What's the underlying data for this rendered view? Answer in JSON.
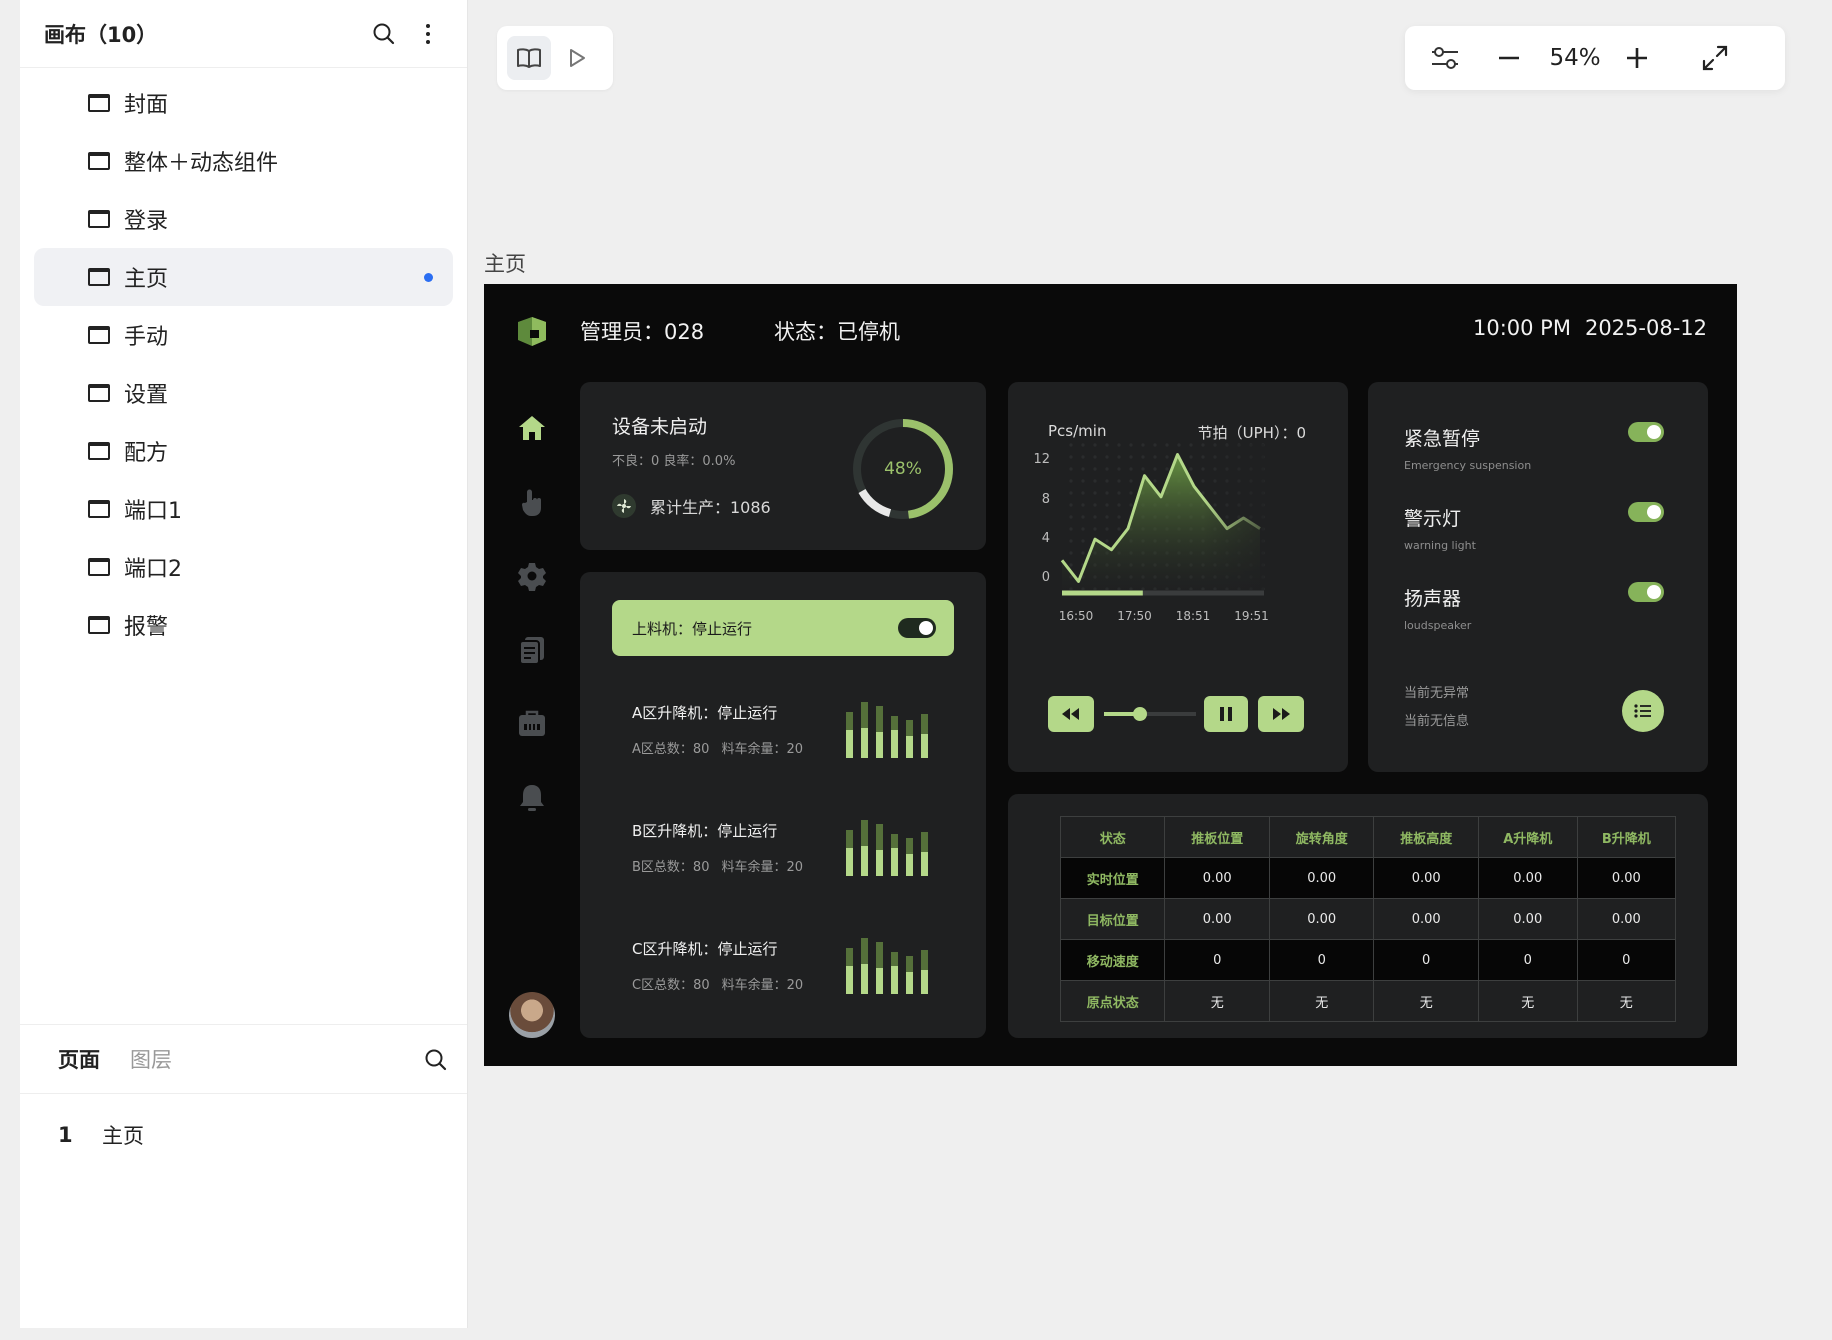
{
  "sidebar": {
    "title": "画布（10）",
    "pages": [
      {
        "label": "封面",
        "active": false
      },
      {
        "label": "整体＋动态组件",
        "active": false
      },
      {
        "label": "登录",
        "active": false
      },
      {
        "label": "主页",
        "active": true
      },
      {
        "label": "手动",
        "active": false
      },
      {
        "label": "设置",
        "active": false
      },
      {
        "label": "配方",
        "active": false
      },
      {
        "label": "端口1",
        "active": false
      },
      {
        "label": "端口2",
        "active": false
      },
      {
        "label": "报警",
        "active": false
      }
    ],
    "tabs": {
      "pages": "页面",
      "layers": "图层"
    },
    "layer": {
      "index": "1",
      "name": "主页"
    }
  },
  "toolbar": {
    "zoom": "54%"
  },
  "frame_label": "主页",
  "dashboard": {
    "admin": "管理员：028",
    "status": "状态：已停机",
    "time": "10:00 PM",
    "date": "2025-08-12",
    "device": {
      "title": "设备未启动",
      "sub": "不良：0  良率：0.0%",
      "accum": "累计生产：1086",
      "progress_percent": 48,
      "progress_label": "48%"
    },
    "feeder": "上料机：停止运行",
    "lifts": [
      {
        "name": "A区升降机：停止运行",
        "total": "A区总数：80",
        "remain": "料车余量：20"
      },
      {
        "name": "B区升降机：停止运行",
        "total": "B区总数：80",
        "remain": "料车余量：20"
      },
      {
        "name": "C区升降机：停止运行",
        "total": "C区总数：80",
        "remain": "料车余量：20"
      }
    ],
    "rate": {
      "unit": "Pcs/min",
      "uph": "节拍（UPH）：0",
      "progress": 0.4
    },
    "alarms": [
      {
        "name": "紧急暂停",
        "sub": "Emergency suspension",
        "on": true
      },
      {
        "name": "警示灯",
        "sub": "warning light",
        "on": true
      },
      {
        "name": "扬声器",
        "sub": "loudspeaker",
        "on": true
      }
    ],
    "messages": [
      "当前无异常",
      "当前无信息"
    ],
    "table": {
      "headers": [
        "状态",
        "推板位置",
        "旋转角度",
        "推板高度",
        "A升降机",
        "B升降机"
      ],
      "rows": [
        [
          "实时位置",
          "0.00",
          "0.00",
          "0.00",
          "0.00",
          "0.00"
        ],
        [
          "目标位置",
          "0.00",
          "0.00",
          "0.00",
          "0.00",
          "0.00"
        ],
        [
          "移动速度",
          "0",
          "0",
          "0",
          "0",
          "0"
        ],
        [
          "原点状态",
          "无",
          "无",
          "无",
          "无",
          "无"
        ]
      ]
    }
  },
  "chart_data": {
    "type": "area",
    "x_ticks": [
      "16:50",
      "17:50",
      "18:51",
      "19:51"
    ],
    "y_ticks": [
      12,
      8,
      4,
      0
    ],
    "ylim": [
      0,
      14
    ],
    "values": [
      3,
      1,
      5,
      4,
      6,
      11,
      9,
      13,
      10,
      8,
      6,
      7,
      6
    ],
    "colors": {
      "accent": "#b4d889",
      "fill_top": "#5f8a3a"
    }
  }
}
